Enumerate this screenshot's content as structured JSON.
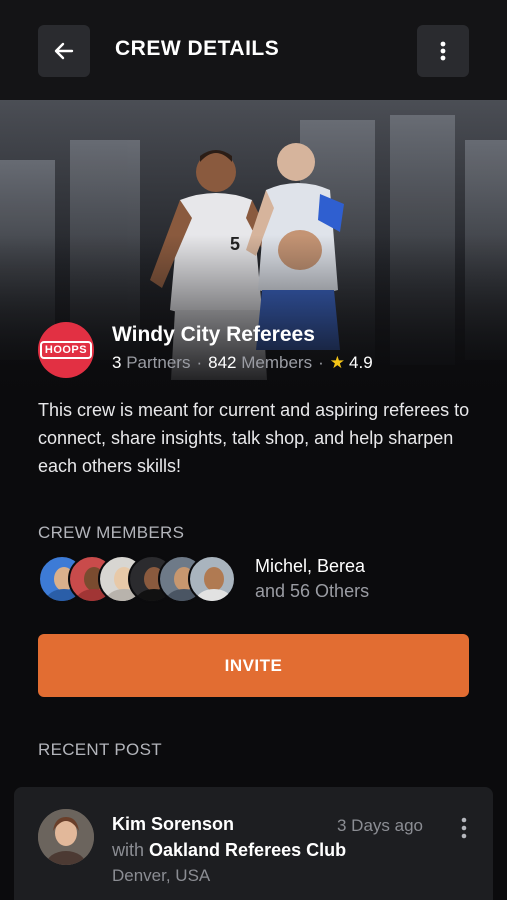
{
  "header": {
    "title": "CREW DETAILS",
    "back_icon": "arrow-left-icon",
    "menu_icon": "more-vertical-icon"
  },
  "crew": {
    "logo_text": "HOOPS",
    "name": "Windy City Referees",
    "partners_count": "3",
    "partners_label": "Partners",
    "members_count": "842",
    "members_label": "Members",
    "rating": "4.9",
    "description": "This crew is meant for current and aspiring referees to connect, share insights, talk shop, and help sharpen each others skills!"
  },
  "members": {
    "section_label": "CREW MEMBERS",
    "names": "Michel, Berea",
    "others": "and 56 Others"
  },
  "invite_label": "INVITE",
  "recent": {
    "section_label": "RECENT POST",
    "author": "Kim Sorenson",
    "time": "3 Days ago",
    "with_label": "with",
    "club": "Oakland Referees Club",
    "location": "Denver, USA"
  },
  "colors": {
    "accent": "#e26d32",
    "logo": "#e23043",
    "star": "#f5c518"
  }
}
